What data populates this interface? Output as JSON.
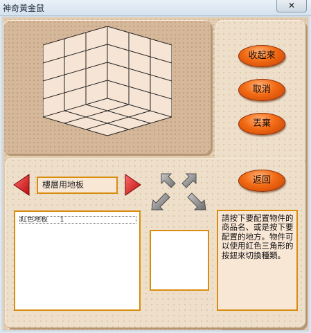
{
  "window": {
    "title": "神奇黃金鼠",
    "close_glyph": "✕"
  },
  "buttons": {
    "collapse": "收起來",
    "cancel": "取消",
    "discard": "丟棄",
    "back": "返回"
  },
  "selector": {
    "current": "樓層用地板"
  },
  "item_list": [
    {
      "name": "紅色地板",
      "count": "1"
    }
  ],
  "help_text": "請按下要配置物件的商品名、或是按下要配置的地方。物件可以使用紅色三角形的按鈕來切換種類。",
  "colors": {
    "accent_border": "#d98d10",
    "orange_button": "#f26a12",
    "red_arrow": "#d81e1e",
    "background": "#e3cdb1"
  },
  "icons": {
    "prev": "red-triangle-left",
    "next": "red-triangle-right",
    "rotate": "four-gray-diagonal-arrows"
  }
}
